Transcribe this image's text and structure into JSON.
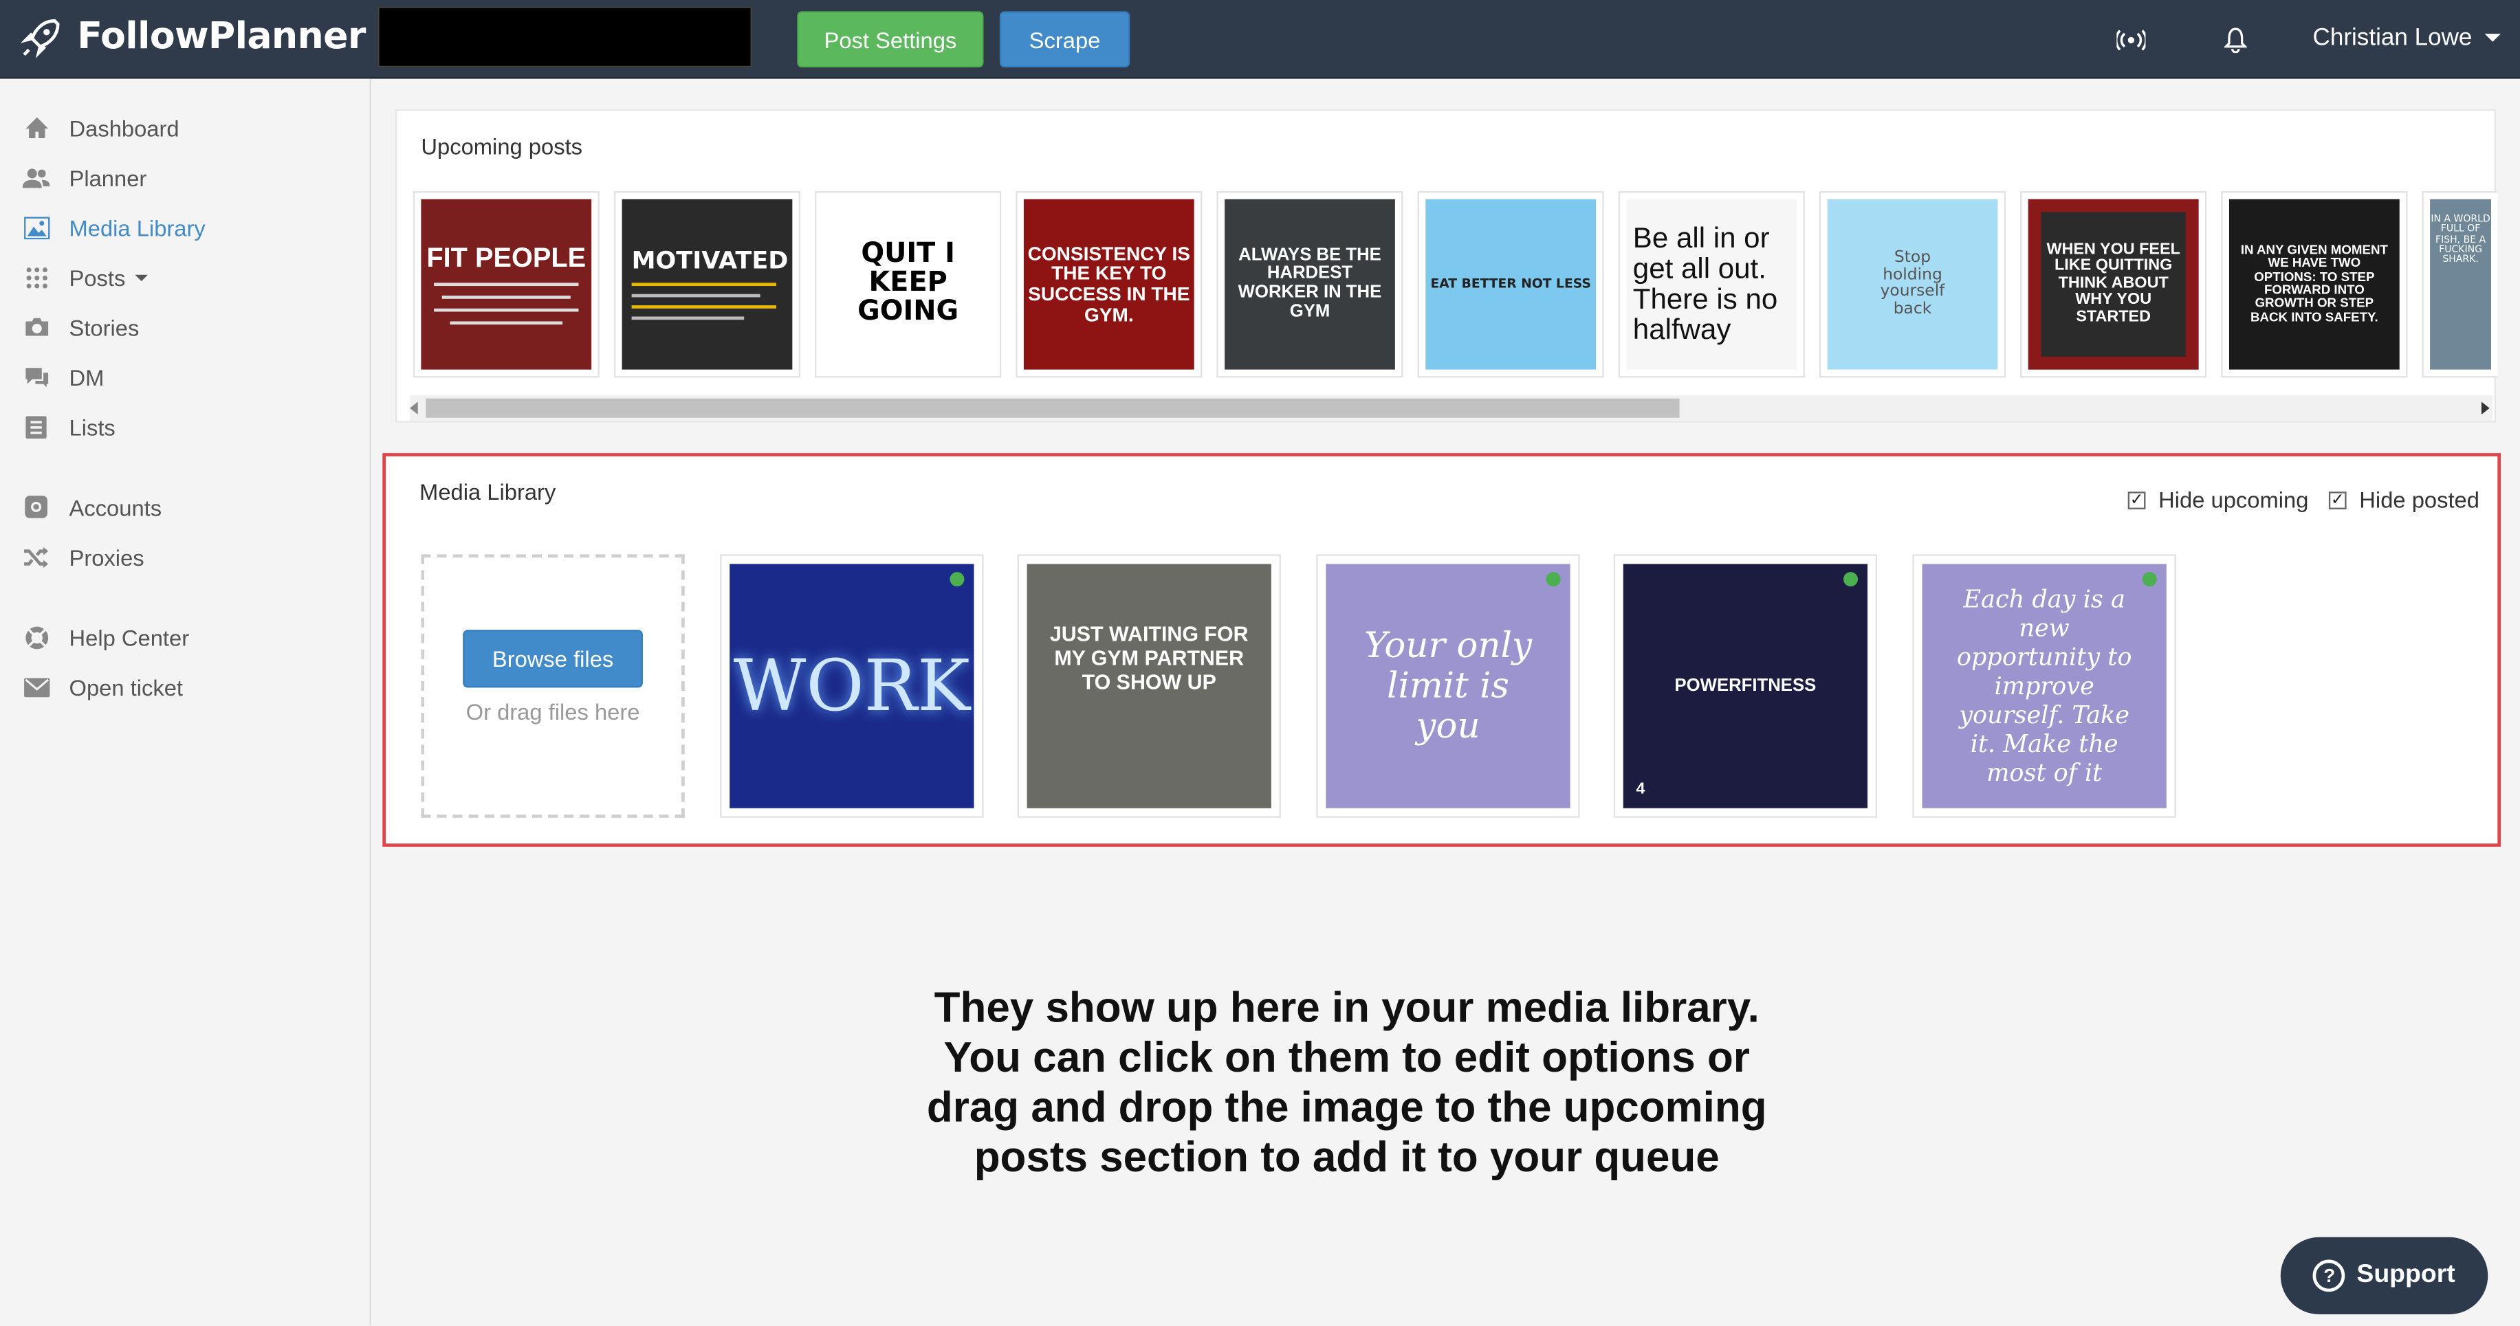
{
  "brand": {
    "name": "FollowPlanner"
  },
  "header": {
    "post_settings_label": "Post Settings",
    "scrape_label": "Scrape",
    "user_name": "Christian Lowe"
  },
  "sidebar": {
    "items": [
      {
        "label": "Dashboard",
        "icon": "home-icon"
      },
      {
        "label": "Planner",
        "icon": "users-icon"
      },
      {
        "label": "Media Library",
        "icon": "image-icon",
        "active": true
      },
      {
        "label": "Posts",
        "icon": "grid-icon"
      },
      {
        "label": "Stories",
        "icon": "camera-icon"
      },
      {
        "label": "DM",
        "icon": "chat-icon"
      },
      {
        "label": "Lists",
        "icon": "list-icon"
      },
      {
        "label": "Accounts",
        "icon": "instagram-icon"
      },
      {
        "label": "Proxies",
        "icon": "shuffle-icon"
      },
      {
        "label": "Help Center",
        "icon": "lifebuoy-icon"
      },
      {
        "label": "Open ticket",
        "icon": "envelope-icon"
      }
    ]
  },
  "upcoming": {
    "title": "Upcoming posts",
    "thumbs": [
      {
        "text": "FIT PEOPLE"
      },
      {
        "text": "MOTIVATED"
      },
      {
        "text": "QUIT I KEEP GOING"
      },
      {
        "text": "CONSISTENCY IS THE KEY TO SUCCESS IN THE GYM."
      },
      {
        "text": "ALWAYS BE THE HARDEST WORKER IN THE GYM"
      },
      {
        "text": "EAT BETTER NOT LESS"
      },
      {
        "text": "Be all in or get all out. There is no halfway"
      },
      {
        "text": "Stop holding yourself back"
      },
      {
        "text": "WHEN YOU FEEL LIKE QUITTING THINK ABOUT WHY YOU STARTED"
      },
      {
        "text": "IN ANY GIVEN MOMENT WE HAVE TWO OPTIONS: TO STEP FORWARD INTO GROWTH OR STEP BACK INTO SAFETY."
      },
      {
        "text": "IN A WORLD FULL OF FISH, BE A FUCKING SHARK."
      }
    ]
  },
  "media": {
    "title": "Media Library",
    "hide_upcoming_label": "Hide upcoming",
    "hide_posted_label": "Hide posted",
    "browse_label": "Browse files",
    "drag_hint": "Or drag files here",
    "items": [
      {
        "text": "WORK"
      },
      {
        "text": "JUST WAITING FOR MY GYM PARTNER TO SHOW UP"
      },
      {
        "text": "Your only limit is you"
      },
      {
        "text": "POWERFITNESS",
        "badge": "4"
      },
      {
        "text": "Each day is a new opportunity to improve yourself. Take it. Make the most of it"
      }
    ]
  },
  "instructions": "They show up here in your media library. You can click on them to edit options or drag and drop the image to the upcoming posts section to add it to your queue",
  "support": {
    "label": "Support"
  },
  "colors": {
    "topbar": "#2f3a4b",
    "accent": "#428bca",
    "green": "#5cb85c",
    "highlight": "#e0444b"
  }
}
